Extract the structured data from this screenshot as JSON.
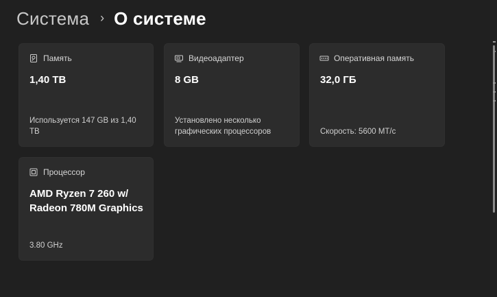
{
  "breadcrumb": {
    "parent": "Система",
    "separator": "›",
    "current": "О системе"
  },
  "cards": {
    "storage": {
      "icon": "storage-icon",
      "title": "Память",
      "value": "1,40 TB",
      "detail": "Используется 147 GB из 1,40 TB"
    },
    "gpu": {
      "icon": "gpu-icon",
      "title": "Видеоадаптер",
      "value": "8 GB",
      "detail": "Установлено несколько графических процессоров"
    },
    "ram": {
      "icon": "ram-icon",
      "title": "Оперативная память",
      "value": "32,0 ГБ",
      "detail": "Скорость: 5600 MT/с"
    },
    "cpu": {
      "icon": "processor-icon",
      "title": "Процессор",
      "value": "AMD Ryzen 7 260 w/ Radeon 780M Graphics",
      "detail": "3.80 GHz"
    }
  },
  "colors": {
    "background": "#202020",
    "card": "#2c2c2c",
    "text_primary": "#ffffff",
    "text_secondary": "#d0d0d0"
  }
}
